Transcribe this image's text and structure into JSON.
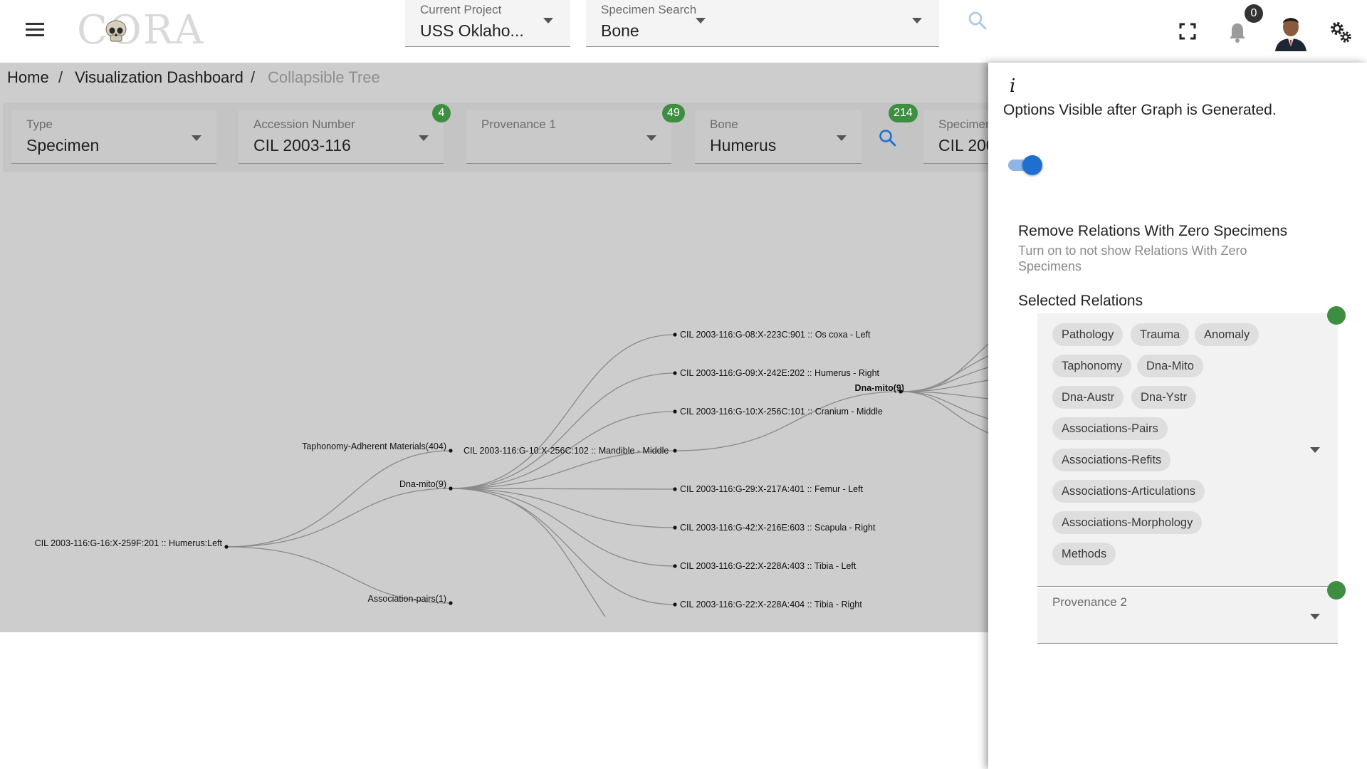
{
  "header": {
    "logo_text": "CORA",
    "current_project": {
      "label": "Current Project",
      "value": "USS Oklaho..."
    },
    "specimen_search": {
      "label": "Specimen Search",
      "value": "Bone"
    },
    "notification_count": "0"
  },
  "breadcrumb": {
    "home": "Home",
    "sep1": "/",
    "dashboard": "Visualization Dashboard",
    "sep2": "/",
    "current": "Collapsible Tree"
  },
  "filters": {
    "type": {
      "label": "Type",
      "value": "Specimen"
    },
    "accession": {
      "label": "Accession Number",
      "value": "CIL 2003-116",
      "badge": "4"
    },
    "provenance1": {
      "label": "Provenance 1",
      "value": "",
      "badge": "49"
    },
    "bone": {
      "label": "Bone",
      "value": "Humerus"
    },
    "search_badge": "214",
    "specimen": {
      "label": "Specimen",
      "value": "CIL 200"
    }
  },
  "tree": {
    "root": "CIL 2003-116:G-16:X-259F:201 :: Humerus:Left",
    "level1": [
      "Taphonomy-Adherent Materials(404)",
      "Dna-mito(9)",
      "Association-pairs(1)"
    ],
    "level2_mandible": "CIL 2003-116:G-10:X-256C:102 :: Mandible - Middle",
    "level2": [
      "CIL 2003-116:G-08:X-223C:901 :: Os coxa - Left",
      "CIL 2003-116:G-09:X-242E:202 :: Humerus - Right",
      "CIL 2003-116:G-10:X-256C:101 :: Cranium - Middle",
      "CIL 2003-116:G-29:X-217A:401 :: Femur - Left",
      "CIL 2003-116:G-42:X-216E:603 :: Scapula - Right",
      "CIL 2003-116:G-22:X-228A:403 :: Tibia - Left",
      "CIL 2003-116:G-22:X-228A:404 :: Tibia - Right"
    ],
    "level3": "Dna-mito(9)"
  },
  "drawer": {
    "info_icon": "i",
    "options_text": "Options Visible after Graph is Generated.",
    "toggle_on": true,
    "setting_title": "Remove Relations With Zero Specimens",
    "setting_desc": "Turn on to not show Relations With Zero Specimens",
    "selected_title": "Selected Relations",
    "relations": [
      "Pathology",
      "Trauma",
      "Anomaly",
      "Taphonomy",
      "Dna-Mito",
      "Dna-Austr",
      "Dna-Ystr",
      "Associations-Pairs",
      "Associations-Refits",
      "Associations-Articulations",
      "Associations-Morphology",
      "Methods"
    ],
    "provenance2": {
      "label": "Provenance 2",
      "value": ""
    }
  },
  "colors": {
    "accent": "#1f6fd1",
    "badge": "#3e8e41",
    "tree_bg": "#cdcdcd",
    "chip": "#dedede"
  }
}
